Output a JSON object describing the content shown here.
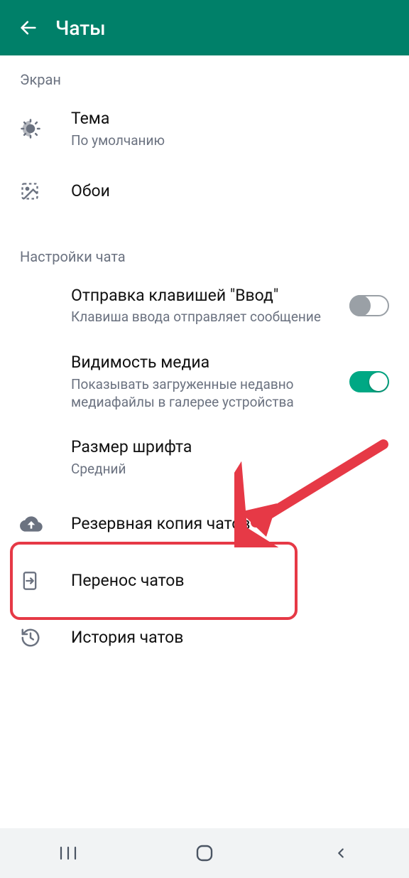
{
  "header": {
    "title": "Чаты"
  },
  "sections": {
    "screen": {
      "label": "Экран",
      "theme": {
        "title": "Тема",
        "sub": "По умолчанию"
      },
      "wallpaper": {
        "title": "Обои"
      }
    },
    "chat_settings": {
      "label": "Настройки чата",
      "enter_send": {
        "title": "Отправка клавишей \"Ввод\"",
        "sub": "Клавиша ввода отправляет сообщение",
        "enabled": false
      },
      "media_visibility": {
        "title": "Видимость медиа",
        "sub": "Показывать загруженные недавно медиафайлы в галерее устройства",
        "enabled": true
      },
      "font_size": {
        "title": "Размер шрифта",
        "sub": "Средний"
      },
      "backup": {
        "title": "Резервная копия чатов"
      },
      "transfer": {
        "title": "Перенос чатов"
      },
      "history": {
        "title": "История чатов"
      }
    }
  }
}
